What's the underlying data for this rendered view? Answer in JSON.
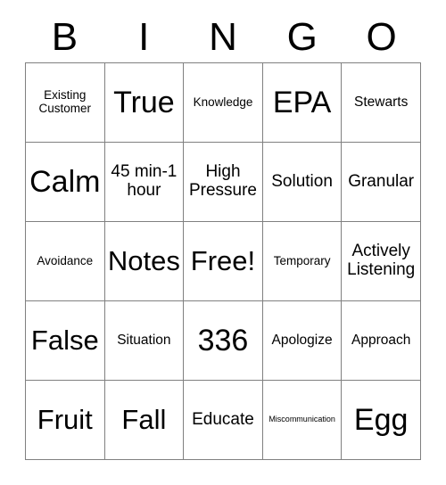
{
  "card": {
    "header": {
      "letters": [
        "B",
        "I",
        "N",
        "G",
        "O"
      ]
    },
    "rows": [
      [
        {
          "text": "Existing Customer",
          "size": "fs-xs"
        },
        {
          "text": "True",
          "size": "fs-xxl"
        },
        {
          "text": "Knowledge",
          "size": "fs-xs"
        },
        {
          "text": "EPA",
          "size": "fs-xxl"
        },
        {
          "text": "Stewarts",
          "size": "fs-s"
        }
      ],
      [
        {
          "text": "Calm",
          "size": "fs-xxl"
        },
        {
          "text": "45 min-1 hour",
          "size": "fs-m"
        },
        {
          "text": "High Pressure",
          "size": "fs-m"
        },
        {
          "text": "Solution",
          "size": "fs-m"
        },
        {
          "text": "Granular",
          "size": "fs-m"
        }
      ],
      [
        {
          "text": "Avoidance",
          "size": "fs-xs"
        },
        {
          "text": "Notes",
          "size": "fs-xl"
        },
        {
          "text": "Free!",
          "size": "fs-xl"
        },
        {
          "text": "Temporary",
          "size": "fs-xs"
        },
        {
          "text": "Actively Listening",
          "size": "fs-m"
        }
      ],
      [
        {
          "text": "False",
          "size": "fs-xl"
        },
        {
          "text": "Situation",
          "size": "fs-s"
        },
        {
          "text": "336",
          "size": "fs-xxl"
        },
        {
          "text": "Apologize",
          "size": "fs-s"
        },
        {
          "text": "Approach",
          "size": "fs-s"
        }
      ],
      [
        {
          "text": "Fruit",
          "size": "fs-xl"
        },
        {
          "text": "Fall",
          "size": "fs-xl"
        },
        {
          "text": "Educate",
          "size": "fs-m"
        },
        {
          "text": "Miscommunication",
          "size": "fs-xxs"
        },
        {
          "text": "Egg",
          "size": "fs-xxl"
        }
      ]
    ],
    "colors": {
      "border": "#808080",
      "background": "#ffffff",
      "text": "#000000"
    }
  }
}
